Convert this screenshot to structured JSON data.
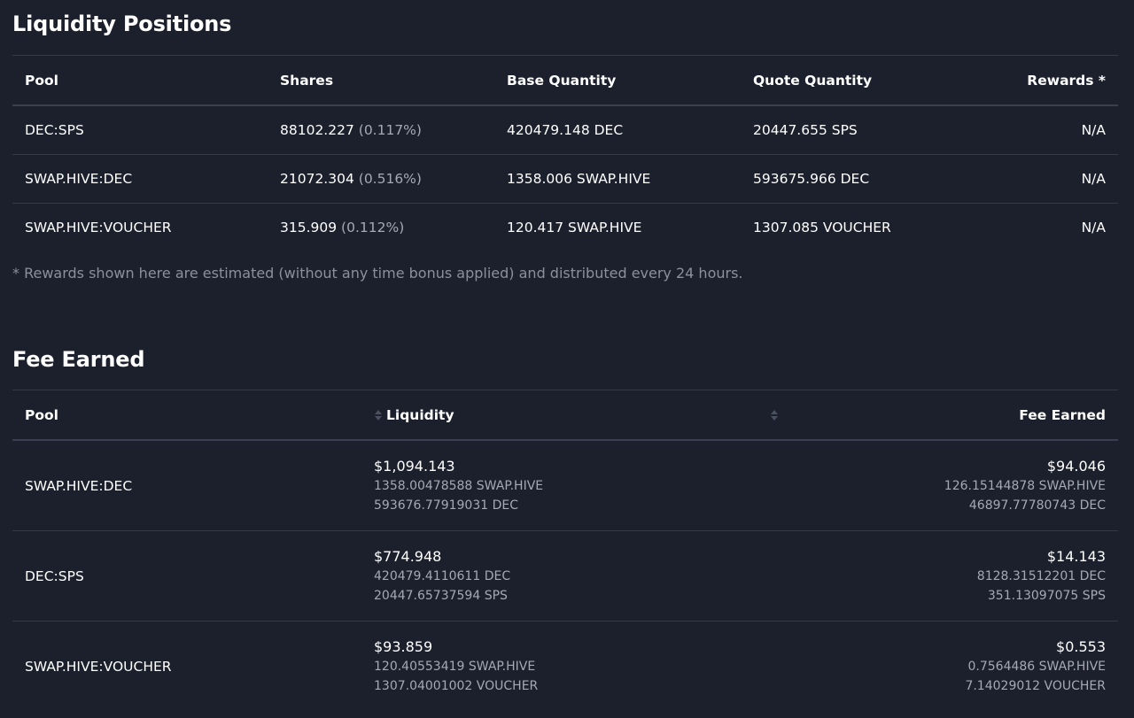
{
  "liquidity_positions": {
    "title": "Liquidity Positions",
    "headers": {
      "pool": "Pool",
      "shares": "Shares",
      "base_quantity": "Base Quantity",
      "quote_quantity": "Quote Quantity",
      "rewards": "Rewards *"
    },
    "rows": [
      {
        "pool": "DEC:SPS",
        "shares": "88102.227",
        "share_pct": "(0.117%)",
        "base": "420479.148 DEC",
        "quote": "20447.655 SPS",
        "rewards": "N/A"
      },
      {
        "pool": "SWAP.HIVE:DEC",
        "shares": "21072.304",
        "share_pct": "(0.516%)",
        "base": "1358.006 SWAP.HIVE",
        "quote": "593675.966 DEC",
        "rewards": "N/A"
      },
      {
        "pool": "SWAP.HIVE:VOUCHER",
        "shares": "315.909",
        "share_pct": "(0.112%)",
        "base": "120.417 SWAP.HIVE",
        "quote": "1307.085 VOUCHER",
        "rewards": "N/A"
      }
    ],
    "footnote": "* Rewards shown here are estimated (without any time bonus applied) and distributed every 24 hours."
  },
  "fee_earned": {
    "title": "Fee Earned",
    "headers": {
      "pool": "Pool",
      "liquidity": "Liquidity",
      "fee_earned": "Fee Earned"
    },
    "rows": [
      {
        "pool": "SWAP.HIVE:DEC",
        "liq_usd": "$1,094.143",
        "liq_a": "1358.00478588 SWAP.HIVE",
        "liq_b": "593676.77919031 DEC",
        "fee_usd": "$94.046",
        "fee_a": "126.15144878 SWAP.HIVE",
        "fee_b": "46897.77780743 DEC"
      },
      {
        "pool": "DEC:SPS",
        "liq_usd": "$774.948",
        "liq_a": "420479.4110611 DEC",
        "liq_b": "20447.65737594 SPS",
        "fee_usd": "$14.143",
        "fee_a": "8128.31512201 DEC",
        "fee_b": "351.13097075 SPS"
      },
      {
        "pool": "SWAP.HIVE:VOUCHER",
        "liq_usd": "$93.859",
        "liq_a": "120.40553419 SWAP.HIVE",
        "liq_b": "1307.04001002 VOUCHER",
        "fee_usd": "$0.553",
        "fee_a": "0.7564486 SWAP.HIVE",
        "fee_b": "7.14029012 VOUCHER"
      }
    ]
  },
  "icons": {
    "sort": "sort-icon"
  },
  "colors": {
    "background": "#1c202c",
    "text": "#ffffff",
    "muted": "#a4a9b6",
    "divider": "#343a48"
  }
}
